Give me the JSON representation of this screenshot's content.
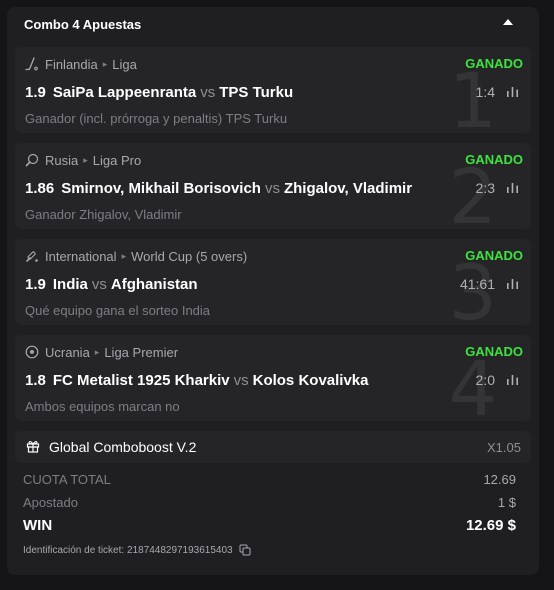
{
  "header": {
    "title": "Combo 4 Apuestas"
  },
  "bets": [
    {
      "country": "Finlandia",
      "league": "Liga",
      "sport_icon": "hockey-stick-icon",
      "status": "GANADO",
      "odds": "1.9",
      "home": "SaiPa Lappeenranta",
      "vs": "vs",
      "away": "TPS Turku",
      "score": "1:4",
      "selection": "Ganador (incl. prórroga y penaltis) TPS Turku",
      "number": "1"
    },
    {
      "country": "Rusia",
      "league": "Liga Pro",
      "sport_icon": "ping-pong-paddle-icon",
      "status": "GANADO",
      "odds": "1.86",
      "home": "Smirnov, Mikhail Borisovich",
      "vs": "vs",
      "away": "Zhigalov, Vladimir",
      "score": "2:3",
      "selection": "Ganador Zhigalov, Vladimir",
      "number": "2"
    },
    {
      "country": "International",
      "league": "World Cup (5 overs)",
      "sport_icon": "cricket-bat-icon",
      "status": "GANADO",
      "odds": "1.9",
      "home": "India",
      "vs": "vs",
      "away": "Afghanistan",
      "score": "41:61",
      "selection": "Qué equipo gana el sorteo India",
      "number": "3"
    },
    {
      "country": "Ucrania",
      "league": "Liga Premier",
      "sport_icon": "soccer-ball-icon",
      "status": "GANADO",
      "odds": "1.8",
      "home": "FC Metalist 1925 Kharkiv",
      "vs": "vs",
      "away": "Kolos Kovalivka",
      "score": "2:0",
      "selection": "Ambos equipos marcan no",
      "number": "4"
    }
  ],
  "boost": {
    "label": "Global Comboboost V.2",
    "value": "X1.05"
  },
  "summary": {
    "total_label": "CUOTA TOTAL",
    "total_value": "12.69",
    "staked_label": "Apostado",
    "staked_value": "1 $",
    "win_label": "WIN",
    "win_value": "12.69 $"
  },
  "ticket": {
    "label": "Identificación de ticket: 2187448297193615403"
  },
  "colors": {
    "background": "#151517",
    "panel": "#1f1f22",
    "card": "#252528",
    "won": "#3ee33e",
    "text": "#ffffff",
    "muted": "#7e7e83"
  }
}
